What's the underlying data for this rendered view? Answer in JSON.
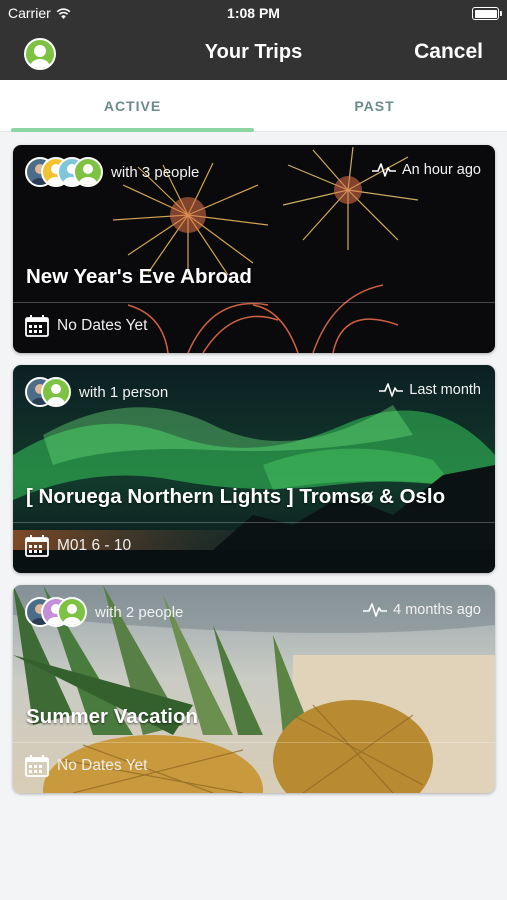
{
  "status_bar": {
    "carrier": "Carrier",
    "time": "1:08 PM"
  },
  "nav": {
    "title": "Your Trips",
    "cancel_label": "Cancel"
  },
  "tabs": [
    {
      "label": "ACTIVE",
      "selected": true
    },
    {
      "label": "PAST",
      "selected": false
    }
  ],
  "trips": [
    {
      "name": "New Year's Eve Abroad",
      "people": "with 3 people",
      "updated": "An hour ago",
      "dates": "No Dates Yet",
      "image": "fireworks"
    },
    {
      "name": "[ Noruega Northern Lights ] Tromsø & Oslo",
      "people": "with 1 person",
      "updated": "Last month",
      "dates": "M01 6 - 10",
      "image": "northern-lights"
    },
    {
      "name": "Summer Vacation",
      "people": "with 2 people",
      "updated": "4 months ago",
      "dates": "No Dates Yet",
      "image": "pineapples"
    }
  ],
  "colors": {
    "bar": "#333333",
    "accent": "#8bd6a3",
    "avatar_green": "#7dc243"
  }
}
